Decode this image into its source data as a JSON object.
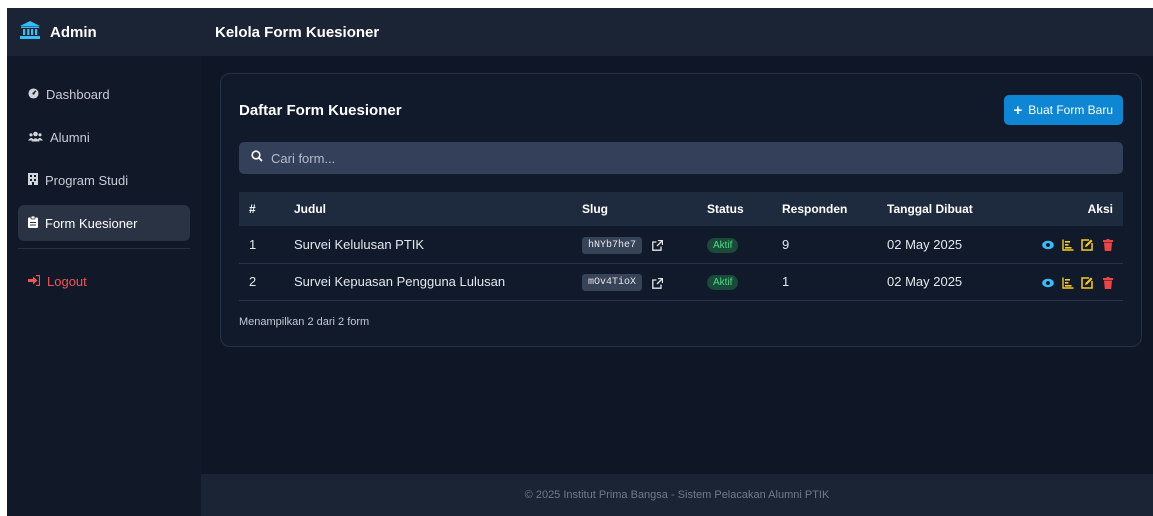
{
  "sidebar": {
    "brand": "Admin",
    "items": [
      {
        "label": "Dashboard",
        "icon": "gauge-icon",
        "active": false
      },
      {
        "label": "Alumni",
        "icon": "users-icon",
        "active": false
      },
      {
        "label": "Program Studi",
        "icon": "building-icon",
        "active": false
      },
      {
        "label": "Form Kuesioner",
        "icon": "clipboard-icon",
        "active": true
      }
    ],
    "logout": "Logout"
  },
  "header": {
    "title": "Kelola Form Kuesioner"
  },
  "card": {
    "title": "Daftar Form Kuesioner",
    "new_button": "Buat Form Baru",
    "search_placeholder": "Cari form...",
    "columns": [
      "#",
      "Judul",
      "Slug",
      "Status",
      "Responden",
      "Tanggal Dibuat",
      "Aksi"
    ],
    "rows": [
      {
        "no": "1",
        "judul": "Survei Kelulusan PTIK",
        "slug": "hNYb7he7",
        "status": "Aktif",
        "responden": "9",
        "tanggal": "02 May 2025"
      },
      {
        "no": "2",
        "judul": "Survei Kepuasan Pengguna Lulusan",
        "slug": "mOv4TioX",
        "status": "Aktif",
        "responden": "1",
        "tanggal": "02 May 2025"
      }
    ],
    "summary": "Menampilkan 2 dari 2 form"
  },
  "footer": {
    "text": "© 2025 Institut Prima Bangsa - Sistem Pelacakan Alumni PTIK"
  },
  "colors": {
    "accent": "#0e86d4",
    "success": "#4ade80",
    "view": "#38bdf8",
    "stats": "#facc15",
    "edit": "#facc15",
    "delete": "#ef4444",
    "logout": "#f05454"
  }
}
